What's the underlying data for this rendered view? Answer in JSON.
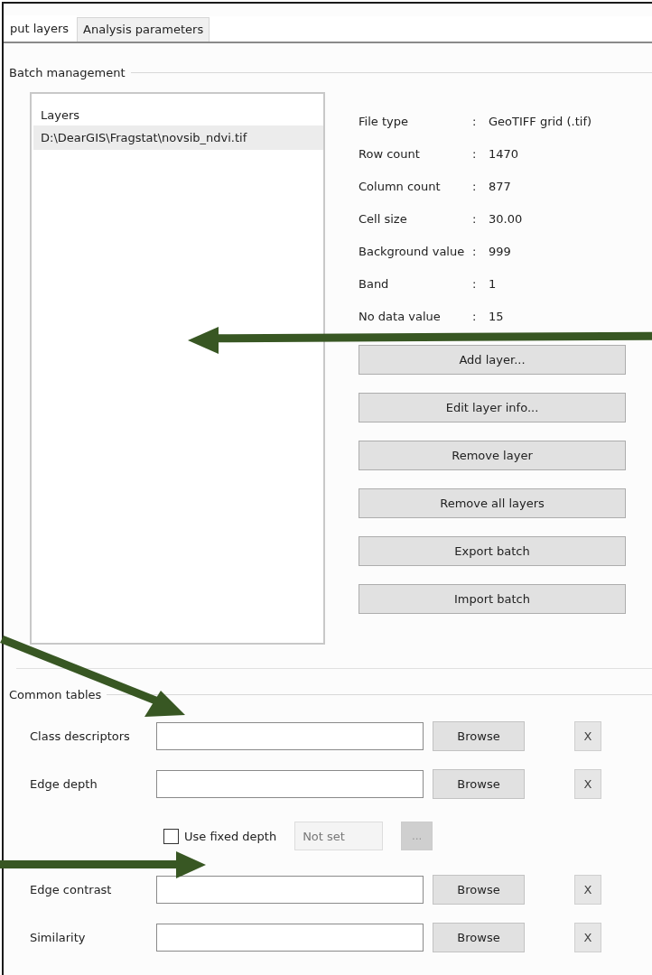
{
  "tabs": [
    {
      "label": "put layers",
      "selected": true
    },
    {
      "label": "Analysis parameters",
      "selected": false
    }
  ],
  "batch_management": {
    "title": "Batch management",
    "layers": {
      "header": "Layers",
      "items": [
        {
          "path": "D:\\DearGIS\\Fragstat\\novsib_ndvi.tif",
          "selected": true
        }
      ]
    },
    "info": [
      {
        "label": "File type",
        "value": "GeoTIFF grid (.tif)"
      },
      {
        "label": "Row count",
        "value": "1470"
      },
      {
        "label": "Column count",
        "value": "877"
      },
      {
        "label": "Cell size",
        "value": "30.00"
      },
      {
        "label": "Background value",
        "value": "999"
      },
      {
        "label": "Band",
        "value": "1"
      },
      {
        "label": "No data value",
        "value": "15"
      }
    ],
    "separator": ":",
    "buttons": [
      "Add layer...",
      "Edit layer info...",
      "Remove layer",
      "Remove all layers",
      "Export batch",
      "Import batch"
    ]
  },
  "common_tables": {
    "title": "Common tables",
    "rows": [
      {
        "kind": "file",
        "label": "Class descriptors",
        "browse": "Browse",
        "clear": "X"
      },
      {
        "kind": "file",
        "label": "Edge depth",
        "browse": "Browse",
        "clear": "X"
      },
      {
        "kind": "fixed",
        "label": "Use fixed depth",
        "checked": false,
        "placeholder": "Not set",
        "more": "...",
        "disabled": true
      },
      {
        "kind": "file",
        "label": "Edge contrast",
        "browse": "Browse",
        "clear": "X"
      },
      {
        "kind": "file",
        "label": "Similarity",
        "browse": "Browse",
        "clear": "X"
      }
    ]
  }
}
